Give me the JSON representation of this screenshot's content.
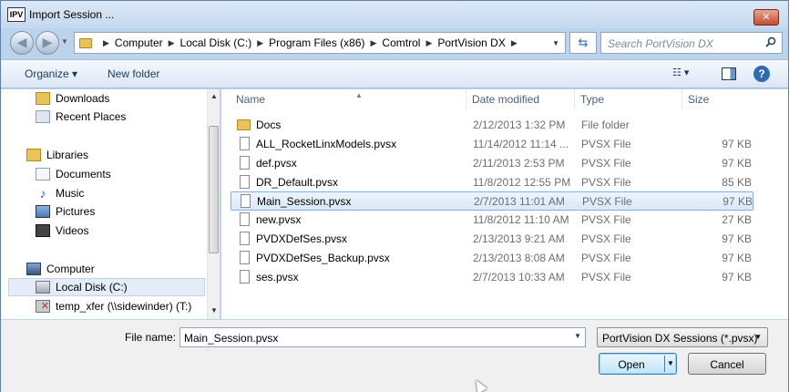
{
  "window": {
    "title": "Import Session ...",
    "app_icon_text": "IPV",
    "close_glyph": "✕"
  },
  "nav": {
    "back_glyph": "◀",
    "forward_glyph": "▶",
    "breadcrumbs": [
      "Computer",
      "Local Disk (C:)",
      "Program Files (x86)",
      "Comtrol",
      "PortVision DX"
    ],
    "search_placeholder": "Search PortVision DX",
    "refresh_glyph": "⇆"
  },
  "toolbar": {
    "organize": "Organize ▾",
    "new_folder": "New folder",
    "views_glyph": "☷ ▾",
    "help_glyph": "?"
  },
  "navpane": [
    {
      "label": "Downloads",
      "icon": "downloads-folder-icon",
      "color": "#e9c25a"
    },
    {
      "label": "Recent Places",
      "icon": "recent-places-icon",
      "color": "#8aa0b9"
    },
    {
      "label": "Libraries",
      "icon": "libraries-icon",
      "color": "#e9c25a"
    },
    {
      "label": "Documents",
      "icon": "documents-icon",
      "color": "#c9d8ea"
    },
    {
      "label": "Music",
      "icon": "music-icon",
      "color": "#2f6ab8"
    },
    {
      "label": "Pictures",
      "icon": "pictures-icon",
      "color": "#5d8bc1"
    },
    {
      "label": "Videos",
      "icon": "videos-icon",
      "color": "#444444"
    },
    {
      "label": "Computer",
      "icon": "computer-icon",
      "color": "#4a6a92"
    },
    {
      "label": "Local Disk (C:)",
      "icon": "local-disk-icon",
      "color": "#9ea9b6"
    },
    {
      "label": "temp_xfer (\\\\sidewinder) (T:)",
      "icon": "network-drive-icon",
      "color": "#b0402c"
    }
  ],
  "columns": {
    "name": "Name",
    "date": "Date modified",
    "type": "Type",
    "size": "Size"
  },
  "files": [
    {
      "name": "Docs",
      "date": "2/12/2013 1:32 PM",
      "type": "File folder",
      "size": "",
      "folder": true
    },
    {
      "name": "ALL_RocketLinxModels.pvsx",
      "date": "11/14/2012 11:14 ...",
      "type": "PVSX File",
      "size": "97 KB"
    },
    {
      "name": "def.pvsx",
      "date": "2/11/2013 2:53 PM",
      "type": "PVSX File",
      "size": "97 KB"
    },
    {
      "name": "DR_Default.pvsx",
      "date": "11/8/2012 12:55 PM",
      "type": "PVSX File",
      "size": "85 KB"
    },
    {
      "name": "Main_Session.pvsx",
      "date": "2/7/2013 11:01 AM",
      "type": "PVSX File",
      "size": "97 KB",
      "selected": true
    },
    {
      "name": "new.pvsx",
      "date": "11/8/2012 11:10 AM",
      "type": "PVSX File",
      "size": "27 KB"
    },
    {
      "name": "PVDXDefSes.pvsx",
      "date": "2/13/2013 9:21 AM",
      "type": "PVSX File",
      "size": "97 KB"
    },
    {
      "name": "PVDXDefSes_Backup.pvsx",
      "date": "2/13/2013 8:08 AM",
      "type": "PVSX File",
      "size": "97 KB"
    },
    {
      "name": "ses.pvsx",
      "date": "2/7/2013 10:33 AM",
      "type": "PVSX File",
      "size": "97 KB"
    }
  ],
  "bottom": {
    "filename_label": "File name:",
    "filename_value": "Main_Session.pvsx",
    "filter_value": "PortVision DX Sessions (*.pvsx)",
    "open_label": "Open",
    "cancel_label": "Cancel",
    "dropdown_glyph": "▼"
  }
}
